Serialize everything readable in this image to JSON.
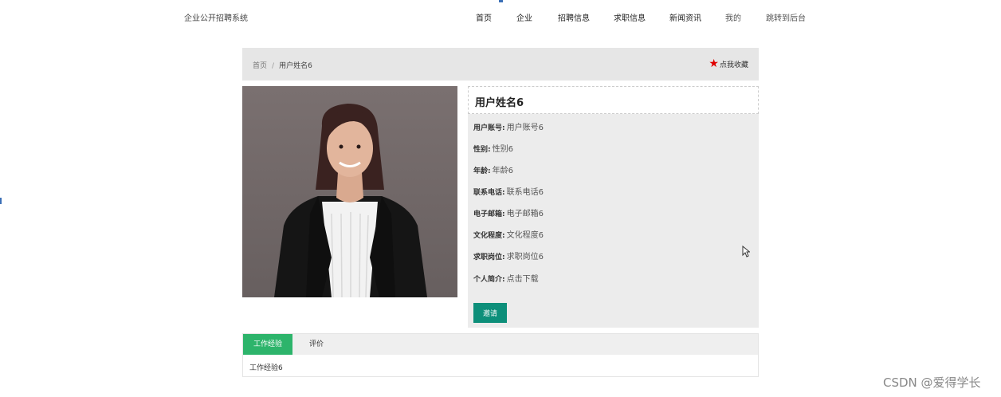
{
  "header": {
    "brand": "企业公开招聘系统",
    "nav": [
      {
        "label": "首页"
      },
      {
        "label": "企业"
      },
      {
        "label": "招聘信息"
      },
      {
        "label": "求职信息"
      },
      {
        "label": "新闻资讯"
      },
      {
        "label": "我的"
      },
      {
        "label": "跳转到后台"
      }
    ]
  },
  "breadcrumb": {
    "home": "首页",
    "separator": "/",
    "current": "用户姓名6"
  },
  "favorite": {
    "icon": "star-icon",
    "label": "点我收藏",
    "color": "#e00000"
  },
  "profile": {
    "name": "用户姓名6",
    "fields": [
      {
        "label": "用户账号:",
        "value": "用户账号6"
      },
      {
        "label": "性别:",
        "value": "性别6"
      },
      {
        "label": "年龄:",
        "value": "年龄6"
      },
      {
        "label": "联系电话:",
        "value": "联系电话6"
      },
      {
        "label": "电子邮箱:",
        "value": "电子邮箱6"
      },
      {
        "label": "文化程度:",
        "value": "文化程度6"
      },
      {
        "label": "求职岗位:",
        "value": "求职岗位6"
      },
      {
        "label": "个人简介:",
        "value": "点击下载"
      }
    ],
    "invite_label": "邀请",
    "invite_color": "#0d8f7a"
  },
  "tabs": {
    "items": [
      {
        "label": "工作经验",
        "active": true
      },
      {
        "label": "评价",
        "active": false
      }
    ],
    "active_color": "#2db46b",
    "content": "工作经验6"
  },
  "watermark": "CSDN @爱得学长"
}
